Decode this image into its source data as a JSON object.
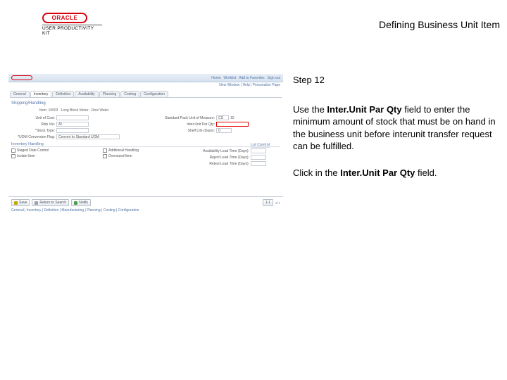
{
  "header": {
    "brand_upk": "USER PRODUCTIVITY KIT",
    "doc_title": "Defining Business Unit Item"
  },
  "panel": {
    "step": "Step 12",
    "para_pre": "Use the ",
    "para_bold": "Inter.Unit Par Qty",
    "para_post": " field to enter the minimum amount of stock that must be on hand in the business unit before interunit transfer request can be fulfilled.",
    "action_pre": "Click in the ",
    "action_bold": "Inter.Unit Par Qty",
    "action_post": " field."
  },
  "shot": {
    "nav_right": [
      "Home",
      "Worklist",
      "Add to Favorites",
      "Sign out"
    ],
    "crumb": "New Window | Help | Personalize Page",
    "tabs": [
      "General",
      "Inventory",
      "Definition",
      "Availability",
      "Planning",
      "Costing",
      "Configuration"
    ],
    "headline": "Shipping/Handling",
    "subline_label": "Item:",
    "subline_item": "10003",
    "subline_desc": "Long Block Motor - Row Water",
    "left_rows": [
      {
        "label": "Unit of Cost:",
        "val": ""
      },
      {
        "label": "Ship Via:",
        "val": "AI"
      },
      {
        "label": "*Stock Type:",
        "val": ""
      },
      {
        "label": "*UOM Conversion Flag:",
        "val": "Convert to Standard UOM"
      }
    ],
    "right_rows": [
      {
        "label": "Standard Pack Unit of Measure:",
        "val": "CS",
        "extra": "10"
      },
      {
        "label": "Inter.Unit Par Qty:",
        "val": "",
        "hot": true
      },
      {
        "label": "Shelf Life (Days):",
        "val": "0"
      }
    ],
    "lot_header": "Lot Control",
    "inv_header": "Inventory Handling",
    "checks_left": [
      "Staged Date Control",
      "Isolate Item"
    ],
    "checks_mid": [
      "Additional Handling",
      "Oversized Item"
    ],
    "checks_right_label": "Reject Lead Time (Days):",
    "checks_right_val": "",
    "checks_right2_label": "Retest Lead Time (Days):",
    "checks_right2_val": "",
    "prob_label": "Availability Lead Time (Days):",
    "prob_val": "",
    "buttons": [
      "Save",
      "Return to Search",
      "Notify"
    ],
    "btn_page": "1-1",
    "btn_page_of": "of 1",
    "footer_links": "General | Inventory | Definition | Manufacturing | Planning | Costing | Configuration"
  }
}
